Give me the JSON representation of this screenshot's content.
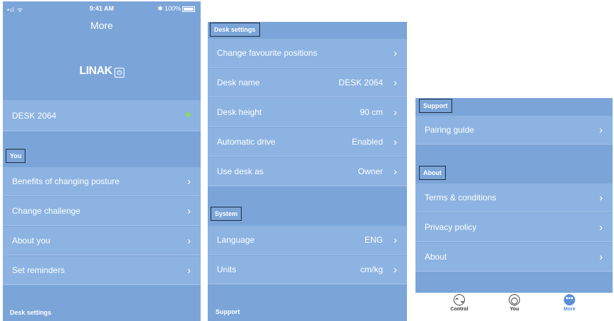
{
  "status": {
    "signal": "•ıl ᯤ",
    "time": "9:41 AM",
    "battery": "✱ 100%"
  },
  "panel1": {
    "title": "More",
    "logo": "LINAK",
    "logo_mark": "⏻",
    "desk": {
      "label": "DESK 2064"
    },
    "you_section": "You",
    "you_items": [
      "Benefits of changing posture",
      "Change challenge",
      "About you",
      "Set reminders"
    ],
    "desk_section": "Desk settings"
  },
  "panel2": {
    "desk_section": "Desk settings",
    "desk_items": [
      {
        "label": "Change favourite positions",
        "value": ""
      },
      {
        "label": "Desk name",
        "value": "DESK 2064"
      },
      {
        "label": "Desk height",
        "value": "90 cm"
      },
      {
        "label": "Automatic drive",
        "value": "Enabled"
      },
      {
        "label": "Use desk as",
        "value": "Owner"
      }
    ],
    "system_section": "System",
    "system_items": [
      {
        "label": "Language",
        "value": "ENG"
      },
      {
        "label": "Units",
        "value": "cm/kg"
      }
    ],
    "support_section": "Support"
  },
  "panel3": {
    "support_section": "Support",
    "support_items": [
      "Pairing guide"
    ],
    "about_section": "About",
    "about_items": [
      "Terms & conditions",
      "Privacy policy",
      "About"
    ],
    "tabs": [
      {
        "label": "Control",
        "icon": "⌃⌄"
      },
      {
        "label": "You",
        "icon": "◯"
      },
      {
        "label": "More",
        "icon": "•••"
      }
    ]
  },
  "icons": {
    "chevron": "›"
  },
  "colors": {
    "background": "#7ba5d8",
    "row": "#8cb3e1",
    "active_tab": "#5b8fd6",
    "status_dot": "#8cd36b"
  }
}
